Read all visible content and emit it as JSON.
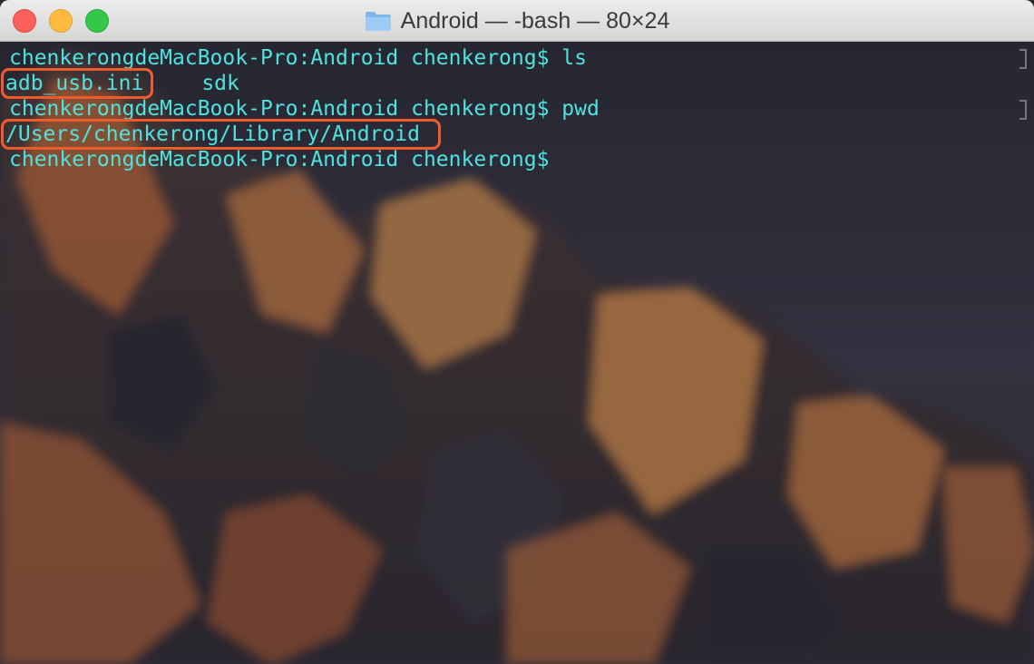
{
  "window": {
    "title": "Android — -bash — 80×24",
    "colors": {
      "close": "#fc605c",
      "minimize": "#fdbc40",
      "zoom": "#34c84a"
    }
  },
  "terminal": {
    "text_color": "#4ee3df",
    "highlight_color": "#ef5b2a",
    "lines": [
      {
        "prompt": "chenkerongdeMacBook-Pro:Android chenkerong$",
        "command": "ls"
      },
      {
        "output": [
          "adb_usb.ini",
          "sdk"
        ]
      },
      {
        "prompt": "chenkerongdeMacBook-Pro:Android chenkerong$",
        "command": "pwd"
      },
      {
        "output": [
          "/Users/chenkerong/Library/Android"
        ]
      },
      {
        "prompt": "chenkerongdeMacBook-Pro:Android chenkerong$",
        "command": ""
      }
    ]
  },
  "icons": {
    "title_folder": "folder-icon"
  }
}
